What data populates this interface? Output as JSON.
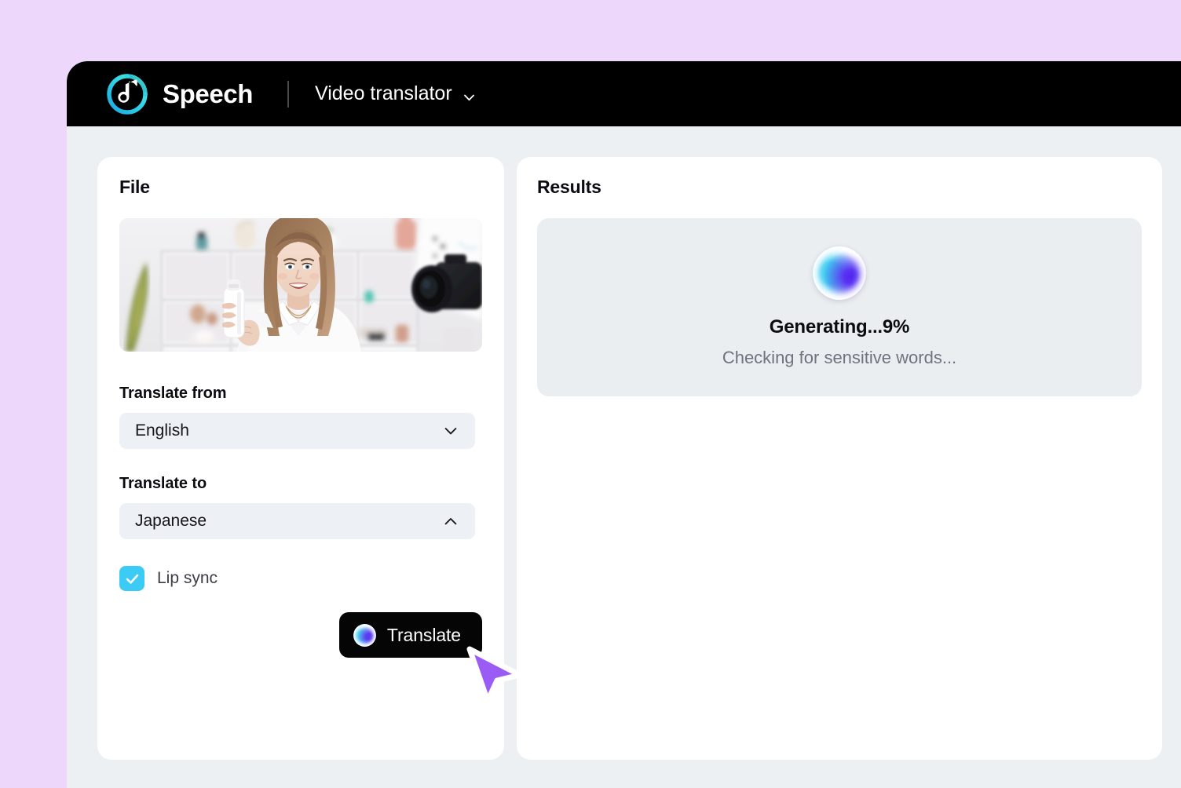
{
  "window": {
    "background_color": "#EDD7FB",
    "content_background": "#EDF0F2"
  },
  "topbar": {
    "logo_icon": "music-note-circle-logo",
    "brand_name": "Speech",
    "divider": "vertical-divider",
    "mode_label": "Video translator",
    "mode_chevron_icon": "chevron-down-icon",
    "background_color": "#000000"
  },
  "file_panel": {
    "title": "File",
    "thumbnail": {
      "icon": "video-thumbnail",
      "alt": "Woman in white studio holding a cosmetic bottle with camera on right"
    },
    "translate_from": {
      "label": "Translate from",
      "value": "English",
      "chevron_icon": "chevron-down-icon"
    },
    "translate_to": {
      "label": "Translate to",
      "value": "Japanese",
      "chevron_icon": "chevron-up-icon"
    },
    "lip_sync": {
      "label": "Lip sync",
      "checked": true,
      "accent_color": "#3CCBF4",
      "check_icon": "checkmark-icon"
    },
    "translate_button": {
      "label": "Translate",
      "icon": "gradient-orb-icon",
      "background_color": "#050505"
    }
  },
  "results_panel": {
    "title": "Results",
    "loading": {
      "orb_icon": "gradient-orb-loading-icon",
      "progress_text": "Generating...9%",
      "progress_percent": 9,
      "status_text": "Checking for sensitive words...",
      "box_color": "#EAEEF1"
    }
  },
  "cursor": {
    "icon": "cursor-arrow-icon",
    "color": "#9B5CF6"
  }
}
